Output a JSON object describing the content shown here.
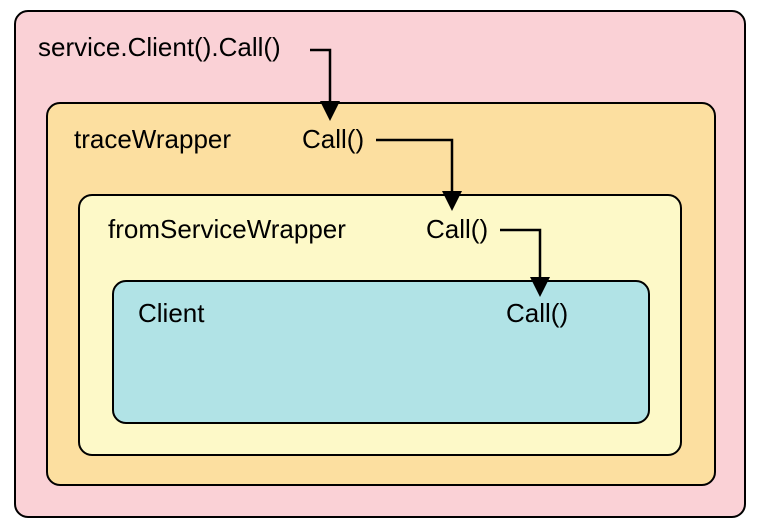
{
  "outer": {
    "title": "service.Client().Call()"
  },
  "traceWrapper": {
    "label": "traceWrapper",
    "call": "Call()"
  },
  "fromServiceWrapper": {
    "label": "fromServiceWrapper",
    "call": "Call()"
  },
  "client": {
    "label": "Client",
    "call": "Call()"
  },
  "colors": {
    "outer": "#fad1d6",
    "trace": "#fcdfa0",
    "from": "#fdf9c8",
    "client": "#b1e3e6"
  }
}
